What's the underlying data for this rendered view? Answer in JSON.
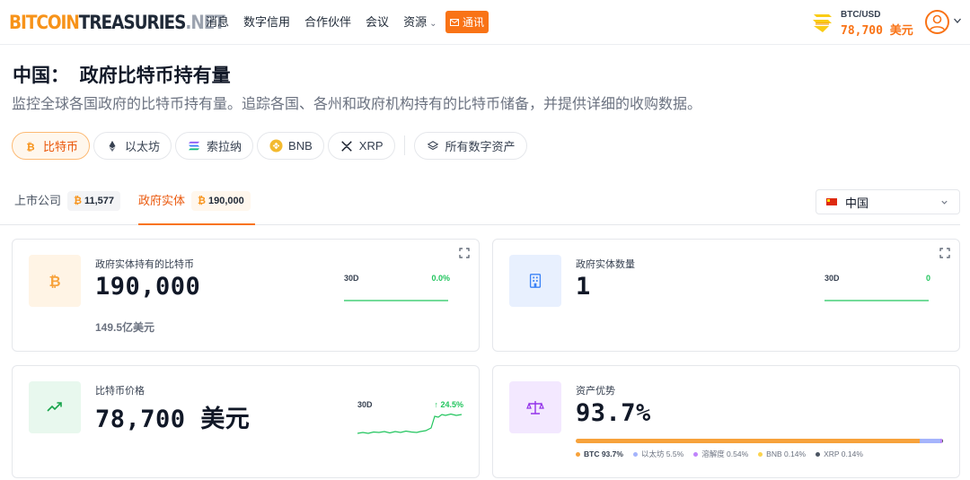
{
  "header": {
    "logo": {
      "part1": "BITCOIN",
      "part2": "TREASURIES",
      "part3": ".NET"
    },
    "nav": [
      {
        "label": "消息"
      },
      {
        "label": "数字信用"
      },
      {
        "label": "合作伙伴"
      },
      {
        "label": "会议"
      },
      {
        "label": "资源",
        "has_dropdown": true
      }
    ],
    "notify_label": "通讯",
    "price_label": "BTC/USD",
    "price_value": "78,700",
    "price_unit": "美元",
    "accent_color": "#f97316"
  },
  "page": {
    "title": "中国：  政府比特币持有量",
    "subtitle": "监控全球各国政府的比特币持有量。追踪各国、各州和政府机构持有的比特币储备，并提供详细的收购数据。"
  },
  "assets": [
    {
      "label": "比特币",
      "icon": "bitcoin-icon",
      "active": true
    },
    {
      "label": "以太坊",
      "icon": "ethereum-icon",
      "active": false
    },
    {
      "label": "索拉纳",
      "icon": "solana-icon",
      "active": false
    },
    {
      "label": "BNB",
      "icon": "bnb-icon",
      "active": false
    },
    {
      "label": "XRP",
      "icon": "xrp-icon",
      "active": false
    },
    {
      "label": "所有数字资产",
      "icon": "layers-icon",
      "active": false
    }
  ],
  "tabs": [
    {
      "label": "上市公司",
      "badge": "11,577",
      "active": false
    },
    {
      "label": "政府实体",
      "badge": "190,000",
      "active": true
    }
  ],
  "country_select": {
    "value": "中国"
  },
  "cards": {
    "holdings": {
      "label": "政府实体持有的比特币",
      "value": "190,000",
      "sub": "149.5亿美元",
      "period": "30D",
      "change": "0.0%"
    },
    "entities": {
      "label": "政府实体数量",
      "value": "1",
      "period": "30D",
      "change": "0"
    },
    "price": {
      "label": "比特币价格",
      "value": "78,700",
      "unit": "美元",
      "period": "30D",
      "change": "↑ 24.5%"
    },
    "dominance": {
      "label": "资产优势",
      "value": "93.7%",
      "segments": [
        {
          "name": "BTC",
          "pct_label": "93.7%",
          "share": 93.7,
          "color": "#f7a23b"
        },
        {
          "name": "以太坊",
          "pct_label": "5.5%",
          "share": 5.5,
          "color": "#a5b4fc"
        },
        {
          "name": "溶解度",
          "pct_label": "0.54%",
          "share": 0.54,
          "color": "#c084fc"
        },
        {
          "name": "BNB",
          "pct_label": "0.14%",
          "share": 0.14,
          "color": "#fcd34d"
        },
        {
          "name": "XRP",
          "pct_label": "0.14%",
          "share": 0.14,
          "color": "#4b5563"
        }
      ]
    }
  },
  "colors": {
    "positive": "#22c55e",
    "bitcoin": "#f7931a"
  }
}
